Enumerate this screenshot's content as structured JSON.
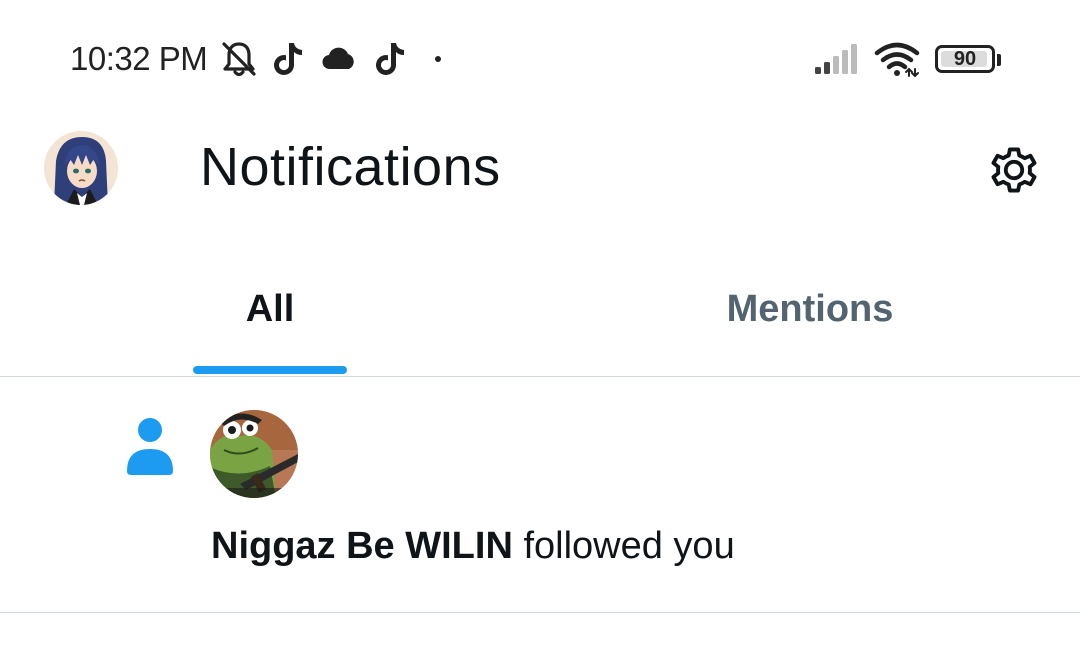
{
  "status_bar": {
    "time": "10:32 PM",
    "battery_level": "90",
    "icons": [
      "bell-muted-icon",
      "tiktok-icon",
      "cloud-icon",
      "tiktok-icon",
      "dot-icon",
      "signal-icon",
      "wifi-icon",
      "battery-icon"
    ]
  },
  "header": {
    "title": "Notifications",
    "avatar_icon": "profile-avatar",
    "settings_icon": "gear-icon"
  },
  "tabs": [
    {
      "label": "All",
      "active": true
    },
    {
      "label": "Mentions",
      "active": false
    }
  ],
  "notifications": [
    {
      "type": "follow",
      "icon": "person-icon",
      "user_name": "Niggaz Be WILIN",
      "action_text": "followed you"
    }
  ],
  "colors": {
    "accent": "#1d9bf0",
    "text_primary": "#0f1419",
    "text_secondary": "#536471",
    "divider": "#cfd9de"
  }
}
